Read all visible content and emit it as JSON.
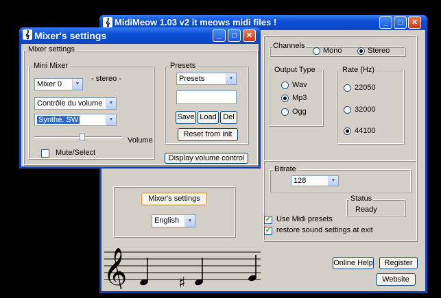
{
  "main_window": {
    "title": "MidiMeow 1.03 v2 it meows midi files !",
    "channels": {
      "label": "Channels",
      "options": [
        "Mono",
        "Stereo"
      ],
      "selected": "Stereo"
    },
    "output_type": {
      "label": "Output Type",
      "options": [
        "Wav",
        "Mp3",
        "Ogg"
      ],
      "selected": "Mp3"
    },
    "rate": {
      "label": "Rate (Hz)",
      "options": [
        "22050",
        "32000",
        "44100"
      ],
      "selected": "44100"
    },
    "bitrate": {
      "label": "Bitrate",
      "value": "128"
    },
    "status": {
      "label": "Status",
      "value": "Ready"
    },
    "use_midi_presets": {
      "label": "Use Midi presets",
      "checked": true
    },
    "restore_settings": {
      "label": "restore sound settings at exit",
      "checked": true
    },
    "mixer_settings_button": "Mixer's settings",
    "language": "English",
    "online_help": "Online Help",
    "register": "Register",
    "website": "Website"
  },
  "mixer_window": {
    "title": "Mixer's settings",
    "group_label": "Mixer settings",
    "mini_mixer": {
      "label": "Mini Mixer",
      "mixer_select": "Mixer 0",
      "stereo_label": "- stereo -",
      "control_select": "Contrôle du volume",
      "device_select": "Synthé. SW",
      "volume_label": "Volume",
      "volume_level": 0.55,
      "mute_label": "Mute/Select",
      "mute_checked": false
    },
    "presets": {
      "label": "Presets",
      "select": "Presets",
      "name_value": "",
      "save": "Save",
      "load": "Load",
      "del": "Del",
      "reset": "Reset from init"
    },
    "display_volume_control": "Display volume control"
  },
  "icons": {
    "app": "treble-clef-icon"
  },
  "colors": {
    "titlebar": "#0a4fd6",
    "face": "#d4d0c8",
    "accent_check": "#21a121"
  }
}
